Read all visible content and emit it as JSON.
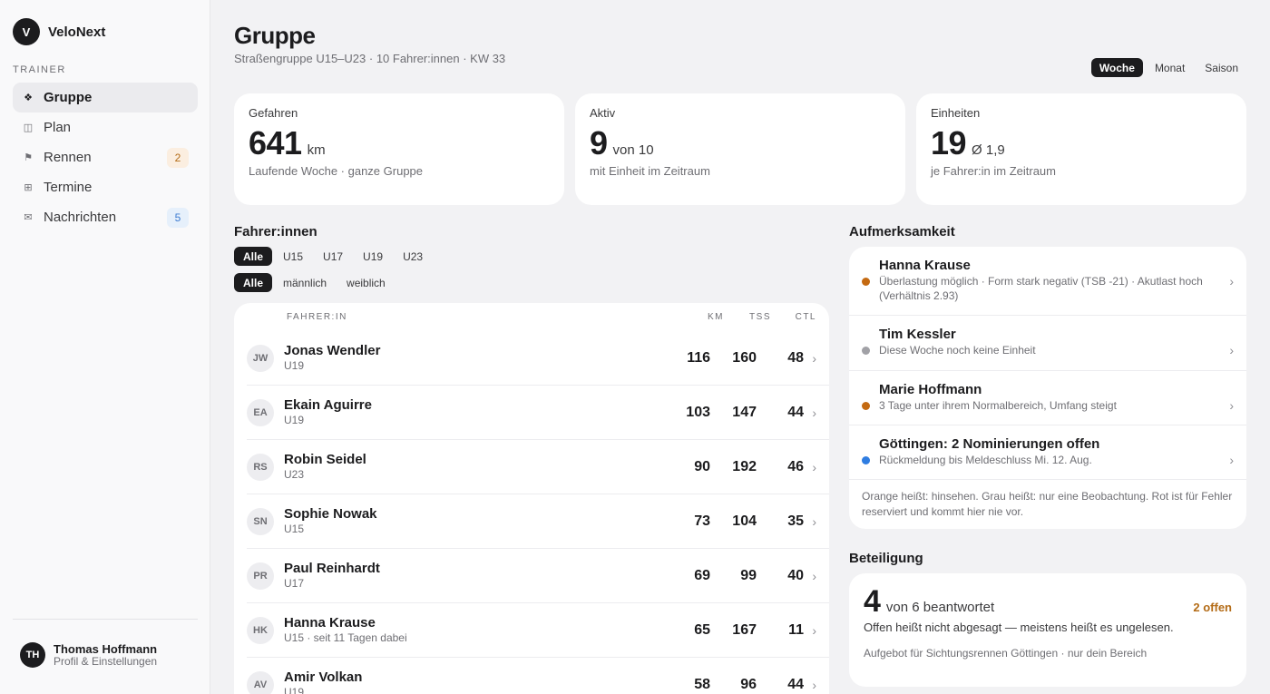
{
  "brand": {
    "logo": "V",
    "name": "VeloNext"
  },
  "sidebar": {
    "section_label": "TRAINER",
    "items": [
      {
        "label": "Gruppe",
        "icon": "diamond-icon",
        "glyph": "❖",
        "badge": ""
      },
      {
        "label": "Plan",
        "icon": "plan-icon",
        "glyph": "◫",
        "badge": ""
      },
      {
        "label": "Rennen",
        "icon": "flag-icon",
        "glyph": "⚑",
        "badge": "2"
      },
      {
        "label": "Termine",
        "icon": "calendar-grid-icon",
        "glyph": "⊞",
        "badge": ""
      },
      {
        "label": "Nachrichten",
        "icon": "mail-icon",
        "glyph": "✉",
        "badge": "5"
      }
    ],
    "user": {
      "initials": "TH",
      "name": "Thomas Hoffmann",
      "sub": "Profil & Einstellungen"
    }
  },
  "header": {
    "title": "Gruppe",
    "subtitle": "Straßengruppe U15–U23 · 10 Fahrer:innen · KW 33",
    "periods": [
      "Woche",
      "Monat",
      "Saison"
    ]
  },
  "kpis": [
    {
      "label": "Gefahren",
      "value": "641",
      "unit": "km",
      "desc": "Laufende Woche · ganze Gruppe"
    },
    {
      "label": "Aktiv",
      "value": "9",
      "unit": "von 10",
      "desc": "mit Einheit im Zeitraum"
    },
    {
      "label": "Einheiten",
      "value": "19",
      "unit": "Ø 1,9",
      "desc": "je Fahrer:in im Zeitraum"
    }
  ],
  "riders": {
    "title": "Fahrer:innen",
    "age_filters": [
      "Alle",
      "U15",
      "U17",
      "U19",
      "U23"
    ],
    "gender_filters": [
      "Alle",
      "männlich",
      "weiblich"
    ],
    "columns": {
      "name": "FAHRER:IN",
      "km": "KM",
      "tss": "TSS",
      "ctl": "CTL"
    },
    "rows": [
      {
        "initials": "JW",
        "name": "Jonas Wendler",
        "sub": "U19",
        "km": "116",
        "tss": "160",
        "ctl": "48"
      },
      {
        "initials": "EA",
        "name": "Ekain Aguirre",
        "sub": "U19",
        "km": "103",
        "tss": "147",
        "ctl": "44"
      },
      {
        "initials": "RS",
        "name": "Robin Seidel",
        "sub": "U23",
        "km": "90",
        "tss": "192",
        "ctl": "46"
      },
      {
        "initials": "SN",
        "name": "Sophie Nowak",
        "sub": "U15",
        "km": "73",
        "tss": "104",
        "ctl": "35"
      },
      {
        "initials": "PR",
        "name": "Paul Reinhardt",
        "sub": "U17",
        "km": "69",
        "tss": "99",
        "ctl": "40"
      },
      {
        "initials": "HK",
        "name": "Hanna Krause",
        "sub": "U15 · seit 11 Tagen dabei",
        "km": "65",
        "tss": "167",
        "ctl": "11"
      },
      {
        "initials": "AV",
        "name": "Amir Volkan",
        "sub": "U19",
        "km": "58",
        "tss": "96",
        "ctl": "44"
      }
    ]
  },
  "attention": {
    "title": "Aufmerksamkeit",
    "items": [
      {
        "title": "Hanna Krause",
        "desc": "Überlastung möglich · Form stark negativ (TSB -21) · Akutlast hoch (Verhältnis 2.93)",
        "color": "#c46a12"
      },
      {
        "title": "Tim Kessler",
        "desc": "Diese Woche noch keine Einheit",
        "color": "#a1a1a6"
      },
      {
        "title": "Marie Hoffmann",
        "desc": "3 Tage unter ihrem Normalbereich, Umfang steigt",
        "color": "#c46a12"
      },
      {
        "title": "Göttingen: 2 Nominierungen offen",
        "desc": "Rückmeldung bis Meldeschluss Mi. 12. Aug.",
        "color": "#2f7de1"
      }
    ],
    "footer": "Orange heißt: hinsehen. Grau heißt: nur eine Beobachtung. Rot ist für Fehler reserviert und kommt hier nie vor."
  },
  "participation": {
    "title": "Beteiligung",
    "value": "4",
    "of": "von 6 beantwortet",
    "open": "2 offen",
    "desc": "Offen heißt nicht abgesagt — meistens heißt es ungelesen.",
    "note": "Aufgebot für Sichtungsrennen Göttingen · nur dein Bereich"
  }
}
